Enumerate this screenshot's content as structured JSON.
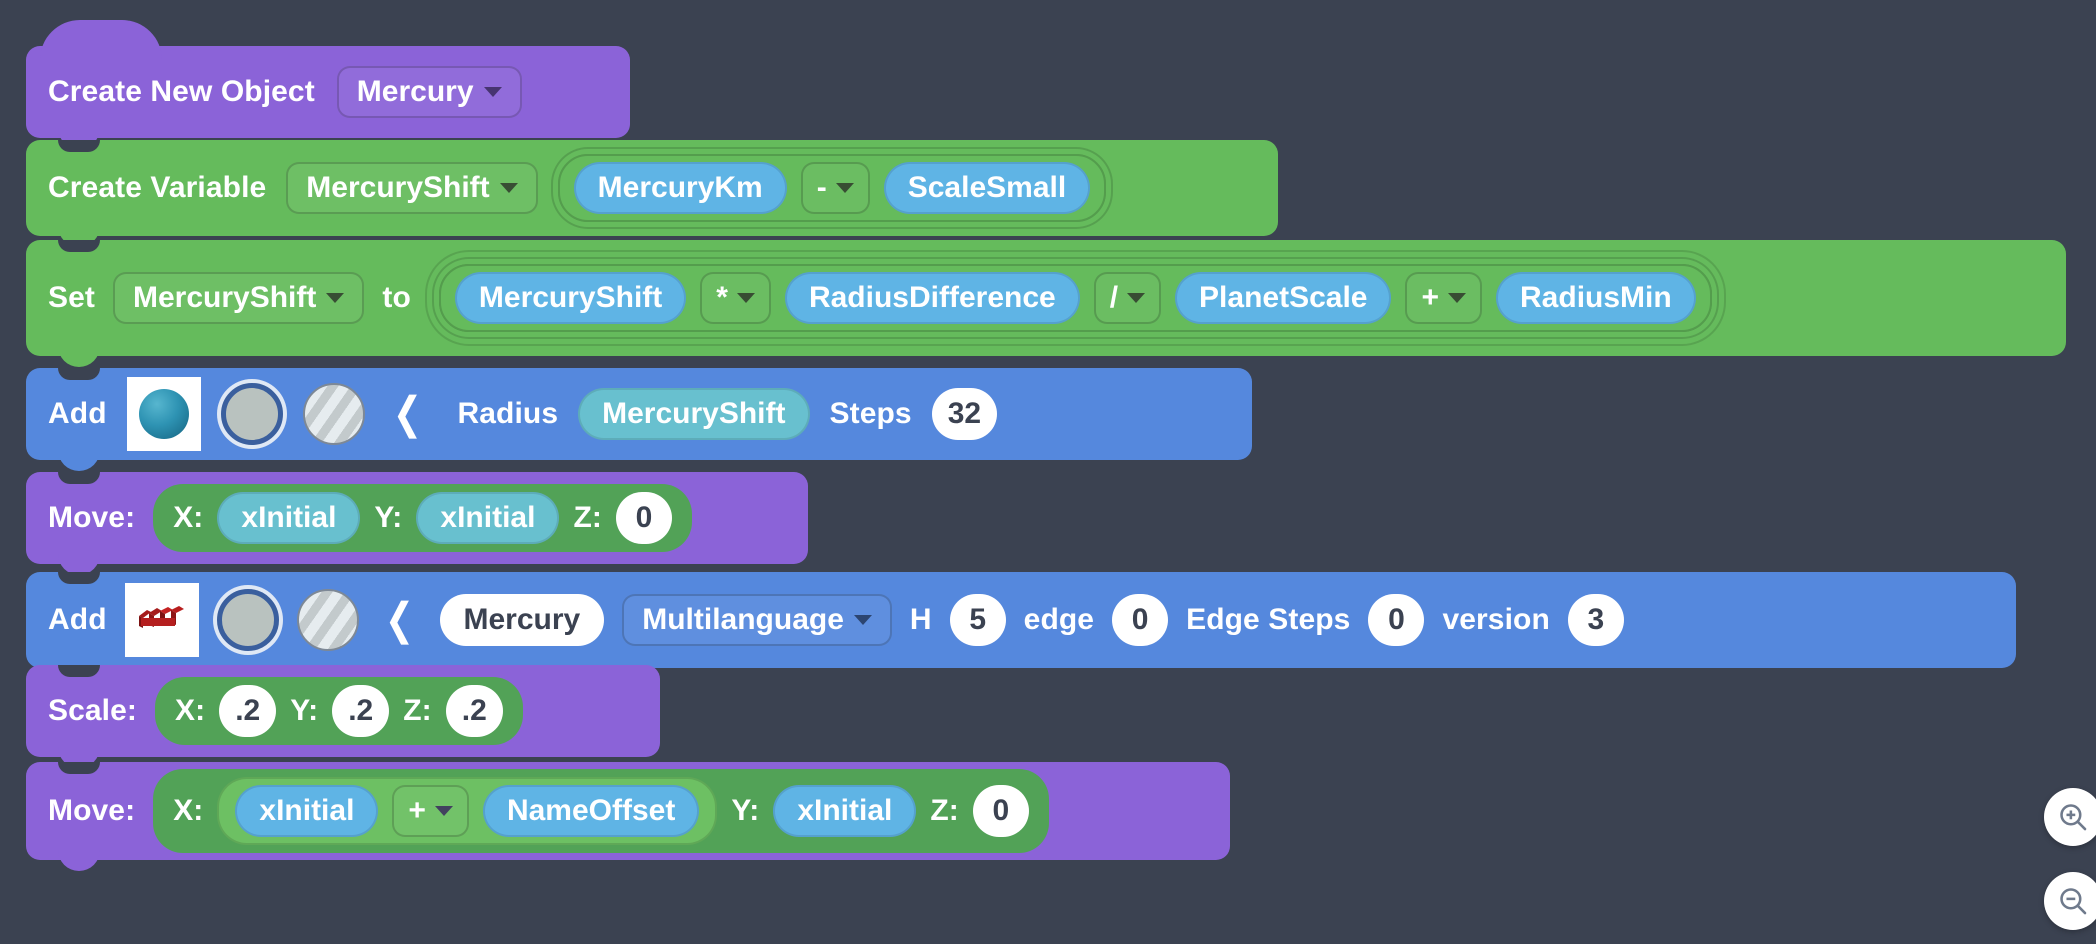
{
  "app": {
    "background_color": "#3b4251",
    "block_colors": {
      "event_purple": "#8b63d8",
      "variable_green": "#65bb5c",
      "object_blue": "#5588dd",
      "variable_pill_blue": "#5fb4e5",
      "variable_pill_teal": "#68c0cf"
    }
  },
  "script": {
    "blocks": [
      {
        "id": "create-new-object",
        "type": "hat",
        "color": "purple",
        "label": "Create New Object",
        "dropdown": {
          "value": "Mercury",
          "caret": "chevron-down-icon"
        }
      },
      {
        "id": "create-variable",
        "type": "stack",
        "color": "green",
        "label": "Create Variable",
        "var_dropdown": {
          "value": "MercuryShift",
          "caret": "chevron-down-icon"
        },
        "expression": {
          "operand_1": "MercuryKm",
          "operator": "-",
          "operand_2": "ScaleSmall"
        }
      },
      {
        "id": "set-variable",
        "type": "stack",
        "color": "green",
        "label": "Set",
        "var_dropdown": {
          "value": "MercuryShift",
          "caret": "chevron-down-icon"
        },
        "to_label": "to",
        "expression": {
          "terms": [
            "MercuryShift",
            "*",
            "RadiusDifference",
            "/",
            "PlanetScale",
            "+",
            "RadiusMin"
          ]
        }
      },
      {
        "id": "add-sphere",
        "type": "stack",
        "color": "blue",
        "label": "Add",
        "thumbnail": "sphere-thumbnail",
        "color_swatch": "color-swatch-icon",
        "texture_swatch": "texture-swatch-icon",
        "collapse": "chevron-left-icon",
        "fields": [
          {
            "label": "Radius",
            "value": "MercuryShift",
            "kind": "variable"
          },
          {
            "label": "Steps",
            "value": "32",
            "kind": "number"
          }
        ]
      },
      {
        "id": "move-sphere",
        "type": "stack",
        "color": "purple",
        "label": "Move:",
        "axes": [
          {
            "label": "X:",
            "value": "xInitial",
            "kind": "variable"
          },
          {
            "label": "Y:",
            "value": "xInitial",
            "kind": "variable"
          },
          {
            "label": "Z:",
            "value": "0",
            "kind": "number"
          }
        ]
      },
      {
        "id": "add-text",
        "type": "stack",
        "color": "blue",
        "label": "Add",
        "thumbnail": "text3d-thumbnail",
        "color_swatch": "color-swatch-icon",
        "texture_swatch": "texture-swatch-icon",
        "collapse": "chevron-left-icon",
        "text_value": "Mercury",
        "language_dropdown": {
          "value": "Multilanguage",
          "caret": "chevron-down-icon"
        },
        "fields": [
          {
            "label": "H",
            "value": "5"
          },
          {
            "label": "edge",
            "value": "0"
          },
          {
            "label": "Edge Steps",
            "value": "0"
          },
          {
            "label": "version",
            "value": "3"
          }
        ]
      },
      {
        "id": "scale-text",
        "type": "stack",
        "color": "purple",
        "label": "Scale:",
        "axes": [
          {
            "label": "X:",
            "value": ".2",
            "kind": "number"
          },
          {
            "label": "Y:",
            "value": ".2",
            "kind": "number"
          },
          {
            "label": "Z:",
            "value": ".2",
            "kind": "number"
          }
        ]
      },
      {
        "id": "move-text",
        "type": "stack",
        "color": "purple",
        "label": "Move:",
        "axes": [
          {
            "label": "X:",
            "kind": "expression",
            "operand_1": "xInitial",
            "operator": "+",
            "operand_2": "NameOffset"
          },
          {
            "label": "Y:",
            "value": "xInitial",
            "kind": "variable"
          },
          {
            "label": "Z:",
            "value": "0",
            "kind": "number"
          }
        ]
      }
    ]
  },
  "controls": {
    "zoom_in": {
      "name": "zoom-in-button",
      "icon": "magnifier-plus-icon"
    },
    "zoom_out": {
      "name": "zoom-out-button",
      "icon": "magnifier-minus-icon"
    }
  }
}
